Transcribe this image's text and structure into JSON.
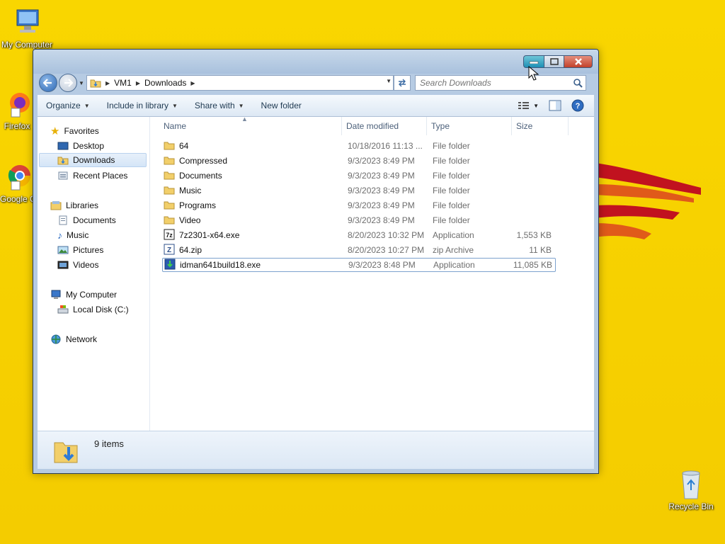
{
  "desktop": {
    "icons": [
      {
        "label": "My Computer"
      },
      {
        "label": "Firefox"
      },
      {
        "label": "Google Chrome"
      },
      {
        "label": "Recycle Bin"
      }
    ]
  },
  "window": {
    "address": {
      "crumbs": [
        "VM1",
        "Downloads"
      ]
    },
    "search": {
      "placeholder": "Search Downloads"
    },
    "toolbar": {
      "organize": "Organize",
      "include_in_library": "Include in library",
      "share_with": "Share with",
      "new_folder": "New folder"
    },
    "nav": {
      "favorites": "Favorites",
      "desktop": "Desktop",
      "downloads": "Downloads",
      "recent_places": "Recent Places",
      "libraries": "Libraries",
      "documents": "Documents",
      "music": "Music",
      "pictures": "Pictures",
      "videos": "Videos",
      "my_computer": "My Computer",
      "local_disk": "Local Disk (C:)",
      "network": "Network"
    },
    "columns": {
      "name": "Name",
      "date_modified": "Date modified",
      "type": "Type",
      "size": "Size"
    },
    "files": [
      {
        "name": "64",
        "date": "10/18/2016 11:13 ...",
        "type": "File folder",
        "size": "",
        "icon": "folder-icon"
      },
      {
        "name": "Compressed",
        "date": "9/3/2023 8:49 PM",
        "type": "File folder",
        "size": "",
        "icon": "folder-icon"
      },
      {
        "name": "Documents",
        "date": "9/3/2023 8:49 PM",
        "type": "File folder",
        "size": "",
        "icon": "folder-icon"
      },
      {
        "name": "Music",
        "date": "9/3/2023 8:49 PM",
        "type": "File folder",
        "size": "",
        "icon": "folder-icon"
      },
      {
        "name": "Programs",
        "date": "9/3/2023 8:49 PM",
        "type": "File folder",
        "size": "",
        "icon": "folder-icon"
      },
      {
        "name": "Video",
        "date": "9/3/2023 8:49 PM",
        "type": "File folder",
        "size": "",
        "icon": "folder-icon"
      },
      {
        "name": "7z2301-x64.exe",
        "date": "8/20/2023 10:32 PM",
        "type": "Application",
        "size": "1,553 KB",
        "icon": "7zip-app-icon"
      },
      {
        "name": "64.zip",
        "date": "8/20/2023 10:27 PM",
        "type": "zip Archive",
        "size": "11 KB",
        "icon": "zip-archive-icon"
      },
      {
        "name": "idman641build18.exe",
        "date": "9/3/2023 8:48 PM",
        "type": "Application",
        "size": "11,085 KB",
        "icon": "idm-app-icon"
      }
    ],
    "status": {
      "item_count": "9 items"
    }
  },
  "colors": {
    "desktop_bg": "#f7d100",
    "selected_nav": "#d4e5f7",
    "close_button": "#c2412b"
  }
}
